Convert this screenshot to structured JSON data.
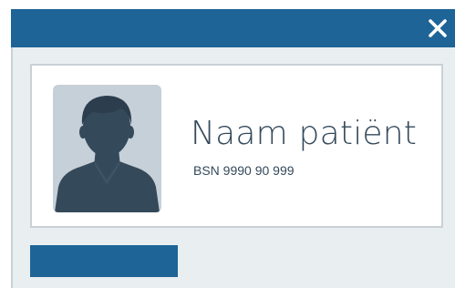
{
  "window": {
    "close_icon": "close-icon",
    "accent_color": "#1e6496"
  },
  "patient_card": {
    "avatar_icon": "person-silhouette-icon",
    "name": "Naam patiënt",
    "bsn": "BSN 9990 90 999"
  },
  "action_button": {
    "label": ""
  }
}
